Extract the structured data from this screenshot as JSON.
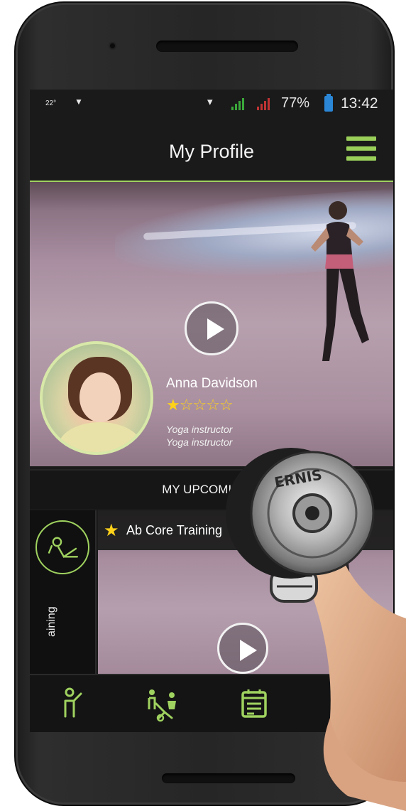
{
  "status_bar": {
    "temperature": "22°",
    "battery_percent": "77%",
    "time": "13:42"
  },
  "app_bar": {
    "title": "My Profile",
    "menu_icon": "hamburger-menu-icon"
  },
  "colors": {
    "accent": "#9fd25f",
    "star": "#ffd21a",
    "battery": "#2b86d6",
    "background": "#1a1a1a"
  },
  "profile": {
    "name": "Anna Davidson",
    "rating": 1,
    "rating_max": 5,
    "role_line_1": "Yoga instructor",
    "role_line_2": "Yoga instructor",
    "video_icon": "play-icon"
  },
  "upcoming": {
    "section_title": "MY UPCOMING S",
    "card": {
      "title": "Ab Core Training",
      "side_label": "aining",
      "side_icon": "ab-crunch-icon"
    }
  },
  "tabs": [
    {
      "icon": "trainer-icon"
    },
    {
      "icon": "training-plan-icon"
    },
    {
      "icon": "calendar-icon"
    }
  ],
  "overlay": {
    "dumbbell_lettering": "ERNIS"
  }
}
